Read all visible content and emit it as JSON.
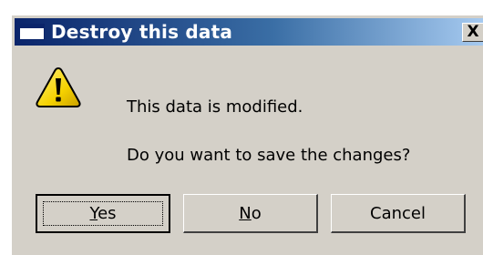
{
  "dialog": {
    "title": "Destroy this data",
    "close_label": "X",
    "icon": "warning-icon",
    "message_line1": "This data is modified.",
    "message_line2": "Do you want to save the changes?"
  },
  "buttons": {
    "yes": {
      "mnemonic": "Y",
      "rest": "es"
    },
    "no": {
      "mnemonic": "N",
      "rest": "o"
    },
    "cancel": "Cancel"
  },
  "colors": {
    "titlebar_start": "#0a246a",
    "titlebar_end": "#a6caf0",
    "dialog_face": "#d4d0c8",
    "warning_yellow": "#f5d100"
  }
}
